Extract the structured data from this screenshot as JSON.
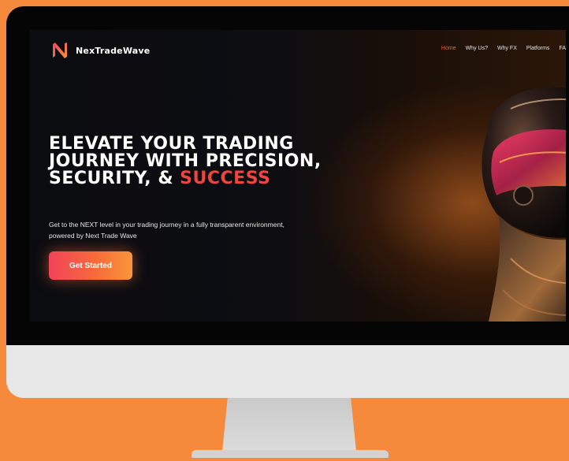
{
  "app": {
    "brand_name": "NexTradeWave",
    "logo_icon": "nextradewave-logo-icon"
  },
  "nav": {
    "items": [
      {
        "label": "Home",
        "active": true
      },
      {
        "label": "Why Us?",
        "active": false
      },
      {
        "label": "Why FX",
        "active": false
      },
      {
        "label": "Platforms",
        "active": false
      },
      {
        "label": "FA",
        "active": false
      }
    ]
  },
  "hero": {
    "headline_line1": "ELEVATE YOUR TRADING",
    "headline_line2": "JOURNEY WITH PRECISION,",
    "headline_line3_prefix": "SECURITY, & ",
    "headline_line3_accent": "SUCCESS",
    "subtext_line1": "Get to the NEXT level in your trading journey in a fully transparent environment,",
    "subtext_line2": "powered by Next Trade Wave",
    "cta_label": "Get Started",
    "illustration": "racing-helmet-image"
  },
  "colors": {
    "page_background": "#f68a3c",
    "screen_background": "#0b0c10",
    "accent": "#f0453c",
    "nav_active": "#ff5a2a",
    "cta_gradient_start": "#f2435a",
    "cta_gradient_end": "#f8963a"
  }
}
